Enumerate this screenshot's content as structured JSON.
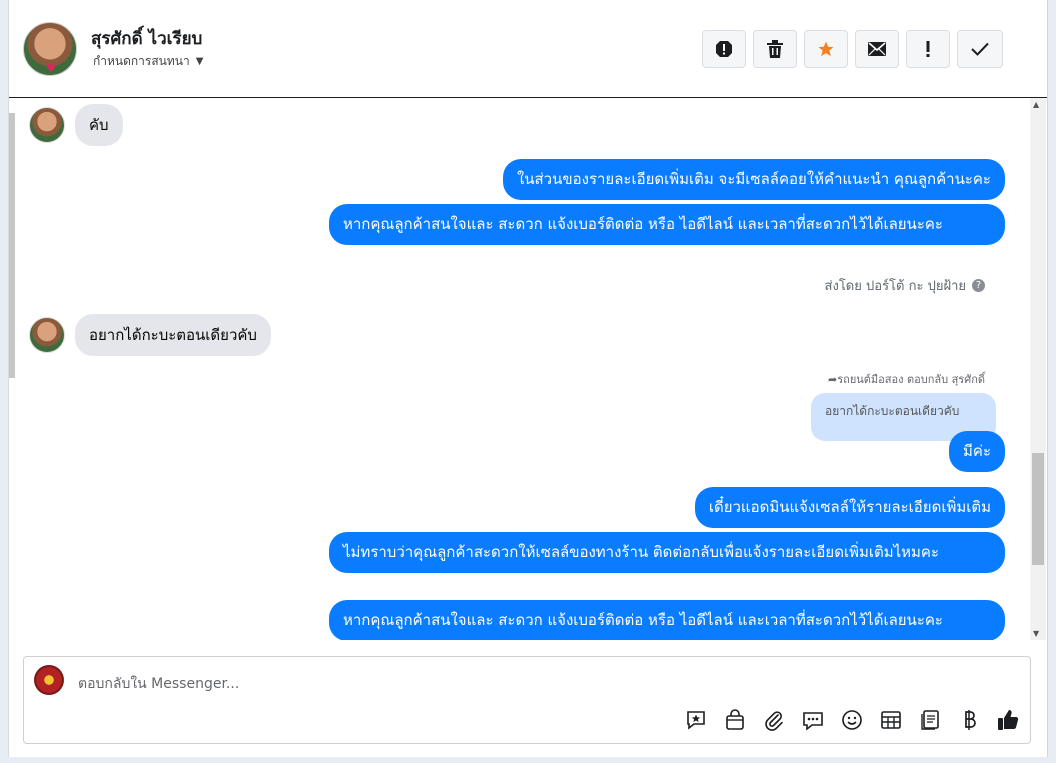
{
  "header": {
    "contact_name": "สุรศักดิ์ ไวเรียบ",
    "assign_label": "กำหนดการสนทนา",
    "actions": [
      {
        "name": "report-icon"
      },
      {
        "name": "trash-icon"
      },
      {
        "name": "star-icon",
        "color": "#f5821f"
      },
      {
        "name": "mail-icon"
      },
      {
        "name": "important-icon"
      },
      {
        "name": "check-icon"
      }
    ]
  },
  "thread": {
    "msg1": "คับ",
    "msg2": "ในส่วนของรายละเอียดเพิ่มเติม จะมีเซลล์คอยให้คำแนะนำ คุณลูกค้านะคะ",
    "msg3": "หากคุณลูกค้าสนใจและ สะดวก แจ้งเบอร์ติดต่อ หรือ ไอดีไลน์ และเวลาที่สะดวกไว้ได้เลยนะคะ",
    "sent_by": "ส่งโดย ปอร์โต้ กะ ปุยฝ้าย",
    "msg4": "อยากได้กะบะตอนเดียวคับ",
    "reply_note": "รถยนต์มือสอง ตอบกลับ สุรศักดิ์",
    "quoted": "อยากได้กะบะตอนเดียวคับ",
    "msg5": "มีค่ะ",
    "msg6": "เดี๋ยวแอดมินแจ้งเซลล์ให้รายละเอียดเพิ่มเติม",
    "msg7": "ไม่ทราบว่าคุณลูกค้าสะดวกให้เซลล์ของทางร้าน ติดต่อกลับเพื่อแจ้งรายละเอียดเพิ่มเติมไหมคะ",
    "msg8": "หากคุณลูกค้าสนใจและ สะดวก แจ้งเบอร์ติดต่อ หรือ ไอดีไลน์ และเวลาที่สะดวกไว้ได้เลยนะคะ"
  },
  "composer": {
    "placeholder": "ตอบกลับใน Messenger...",
    "tools": [
      "saved-reply-icon",
      "shop-icon",
      "attach-icon",
      "chat-icon",
      "emoji-icon",
      "table-icon",
      "notes-icon",
      "baht-icon",
      "like-icon"
    ]
  },
  "colors": {
    "accent": "#0a7cff",
    "incoming": "#e4e6eb",
    "quote_bg": "#cfe3ff"
  }
}
